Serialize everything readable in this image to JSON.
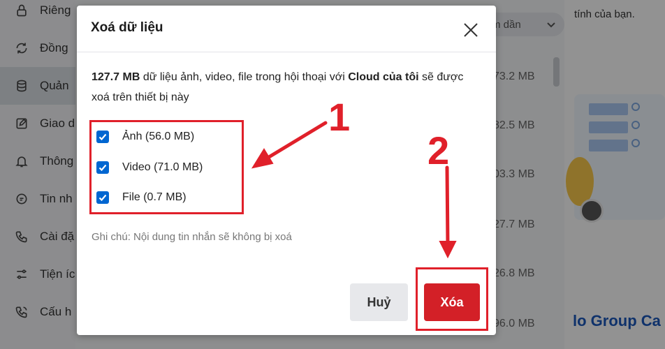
{
  "sidebar": {
    "items": [
      {
        "label": "Riêng",
        "icon": "lock-icon"
      },
      {
        "label": "Đồng",
        "icon": "sync-icon"
      },
      {
        "label": "Quản",
        "icon": "database-icon"
      },
      {
        "label": "Giao d",
        "icon": "edit-icon"
      },
      {
        "label": "Thông",
        "icon": "bell-icon"
      },
      {
        "label": "Tin nh",
        "icon": "chat-icon"
      },
      {
        "label": "Cài đặ",
        "icon": "phone-icon"
      },
      {
        "label": "Tiện íc",
        "icon": "sliders-icon"
      },
      {
        "label": "Cấu h",
        "icon": "call-settings-icon"
      }
    ]
  },
  "list": {
    "sort_label": "m dần",
    "sizes": [
      "73.2 MB",
      "82.5 MB",
      "03.3 MB",
      "27.7 MB",
      "26.8 MB",
      "96.0 MB"
    ]
  },
  "right_panel": {
    "top_text": "tính của bạn.",
    "bottom_text": "lo Group Ca"
  },
  "dialog": {
    "title": "Xoá dữ liệu",
    "desc_size": "127.7 MB",
    "desc_mid": " dữ liệu ảnh, video, file trong hội thoại với ",
    "desc_cloud": "Cloud của tôi",
    "desc_end": " sẽ được xoá trên thiết bị này",
    "options": [
      {
        "label": "Ảnh (56.0 MB)",
        "checked": true
      },
      {
        "label": "Video (71.0 MB)",
        "checked": true
      },
      {
        "label": "File (0.7 MB)",
        "checked": true
      }
    ],
    "note": "Ghi chú: Nội dung tin nhắn sẽ không bị xoá",
    "cancel_label": "Huỷ",
    "delete_label": "Xóa"
  },
  "annotations": {
    "step1": "1",
    "step2": "2",
    "color": "#e0202a"
  },
  "colors": {
    "accent": "#0066d1",
    "danger": "#d32027"
  }
}
